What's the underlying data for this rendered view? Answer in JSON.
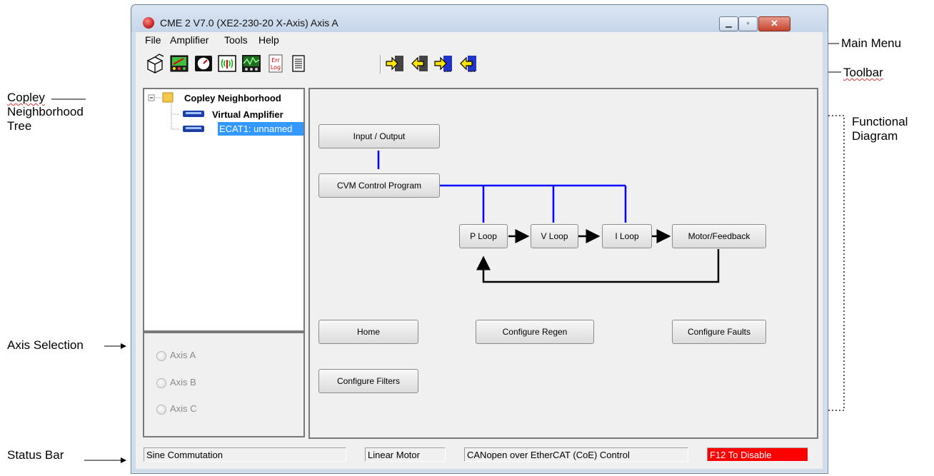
{
  "window": {
    "title": "CME 2 V7.0 (XE2-230-20 X-Axis) Axis A"
  },
  "menu": [
    "File",
    "Amplifier",
    "Tools",
    "Help"
  ],
  "toolbar": {
    "icons": [
      "open-icon",
      "meter-icon",
      "gauge-icon",
      "signal-icon",
      "scope-icon",
      "error-log-icon",
      "document-icon",
      "export-icon",
      "import-icon",
      "download-icon",
      "upload-icon"
    ],
    "error_log_text": "Err Log"
  },
  "tree": {
    "root": "Copley Neighborhood",
    "items": [
      "Virtual Amplifier",
      "ECAT1: unnamed"
    ]
  },
  "axis_selection": {
    "options": [
      "Axis A",
      "Axis B",
      "Axis C"
    ]
  },
  "diagram": {
    "buttons": {
      "input_output": "Input / Output",
      "cvm": "CVM Control Program",
      "p_loop": "P Loop",
      "v_loop": "V Loop",
      "i_loop": "I Loop",
      "motor_feedback": "Motor/Feedback",
      "home": "Home",
      "configure_regen": "Configure Regen",
      "configure_faults": "Configure Faults",
      "configure_filters": "Configure Filters"
    }
  },
  "status_bar": {
    "commutation": "Sine Commutation",
    "motor": "Linear Motor",
    "control": "CANopen over EtherCAT (CoE) Control",
    "disable": "F12 To Disable"
  },
  "annotations": {
    "main_menu": "Main Menu",
    "toolbar": "Toolbar",
    "tree_line1": "Copley",
    "tree_line2": "Neighborhood",
    "tree_line3": "Tree",
    "functional_line1": "Functional",
    "functional_line2": "Diagram",
    "axis_selection": "Axis Selection",
    "status_bar": "Status Bar"
  },
  "colors": {
    "status_disable_bg": "#ff0000",
    "selection_bg": "#3399ff",
    "diagram_lines": "#0000ff"
  }
}
